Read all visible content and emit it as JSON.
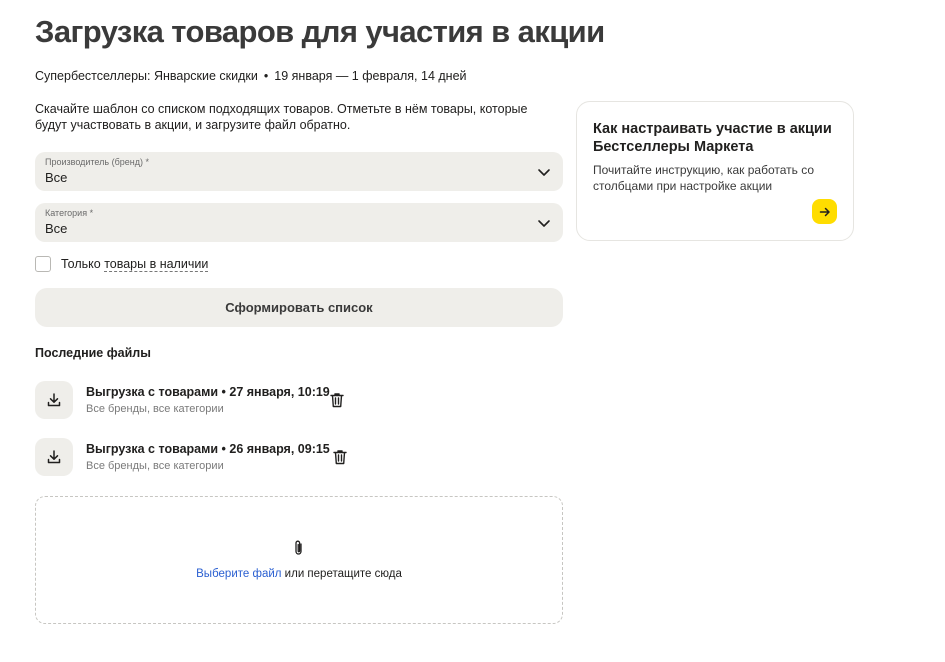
{
  "header": {
    "title": "Загрузка товаров для участия в акции"
  },
  "promo": {
    "name": "Супербестселлеры: Январские скидки",
    "separator": "•",
    "dates": "19 января — 1 февраля, 14 дней"
  },
  "description": "Скачайте шаблон со списком подходящих товаров. Отметьте в нём товары, которые будут участвовать в акции, и загрузите файл обратно.",
  "filters": {
    "brand": {
      "label": "Производитель (бренд) *",
      "value": "Все"
    },
    "category": {
      "label": "Категория *",
      "value": "Все"
    },
    "in_stock": {
      "label_prefix": "Только ",
      "label_link": "товары в наличии",
      "checked": false
    }
  },
  "generate_button": "Сформировать список",
  "recent_files": {
    "title": "Последние файлы",
    "items": [
      {
        "name": "Выгрузка с товарами • 27 января, 10:19",
        "meta": "Все бренды, все категории"
      },
      {
        "name": "Выгрузка с товарами • 26 января, 09:15",
        "meta": "Все бренды, все категории"
      }
    ]
  },
  "upload": {
    "link_text": "Выберите файл",
    "rest_text": " или перетащите сюда"
  },
  "help_card": {
    "title": "Как настраивать участие в акции Бестселлеры Маркета",
    "text": "Почитайте инструкцию, как работать со столбцами при настройке акции",
    "accent_color": "#ffdd00"
  },
  "icons": {
    "chevron": "chevron-down-icon",
    "download": "download-icon",
    "trash": "trash-icon",
    "clip": "paperclip-icon",
    "arrow": "arrow-right-icon"
  }
}
